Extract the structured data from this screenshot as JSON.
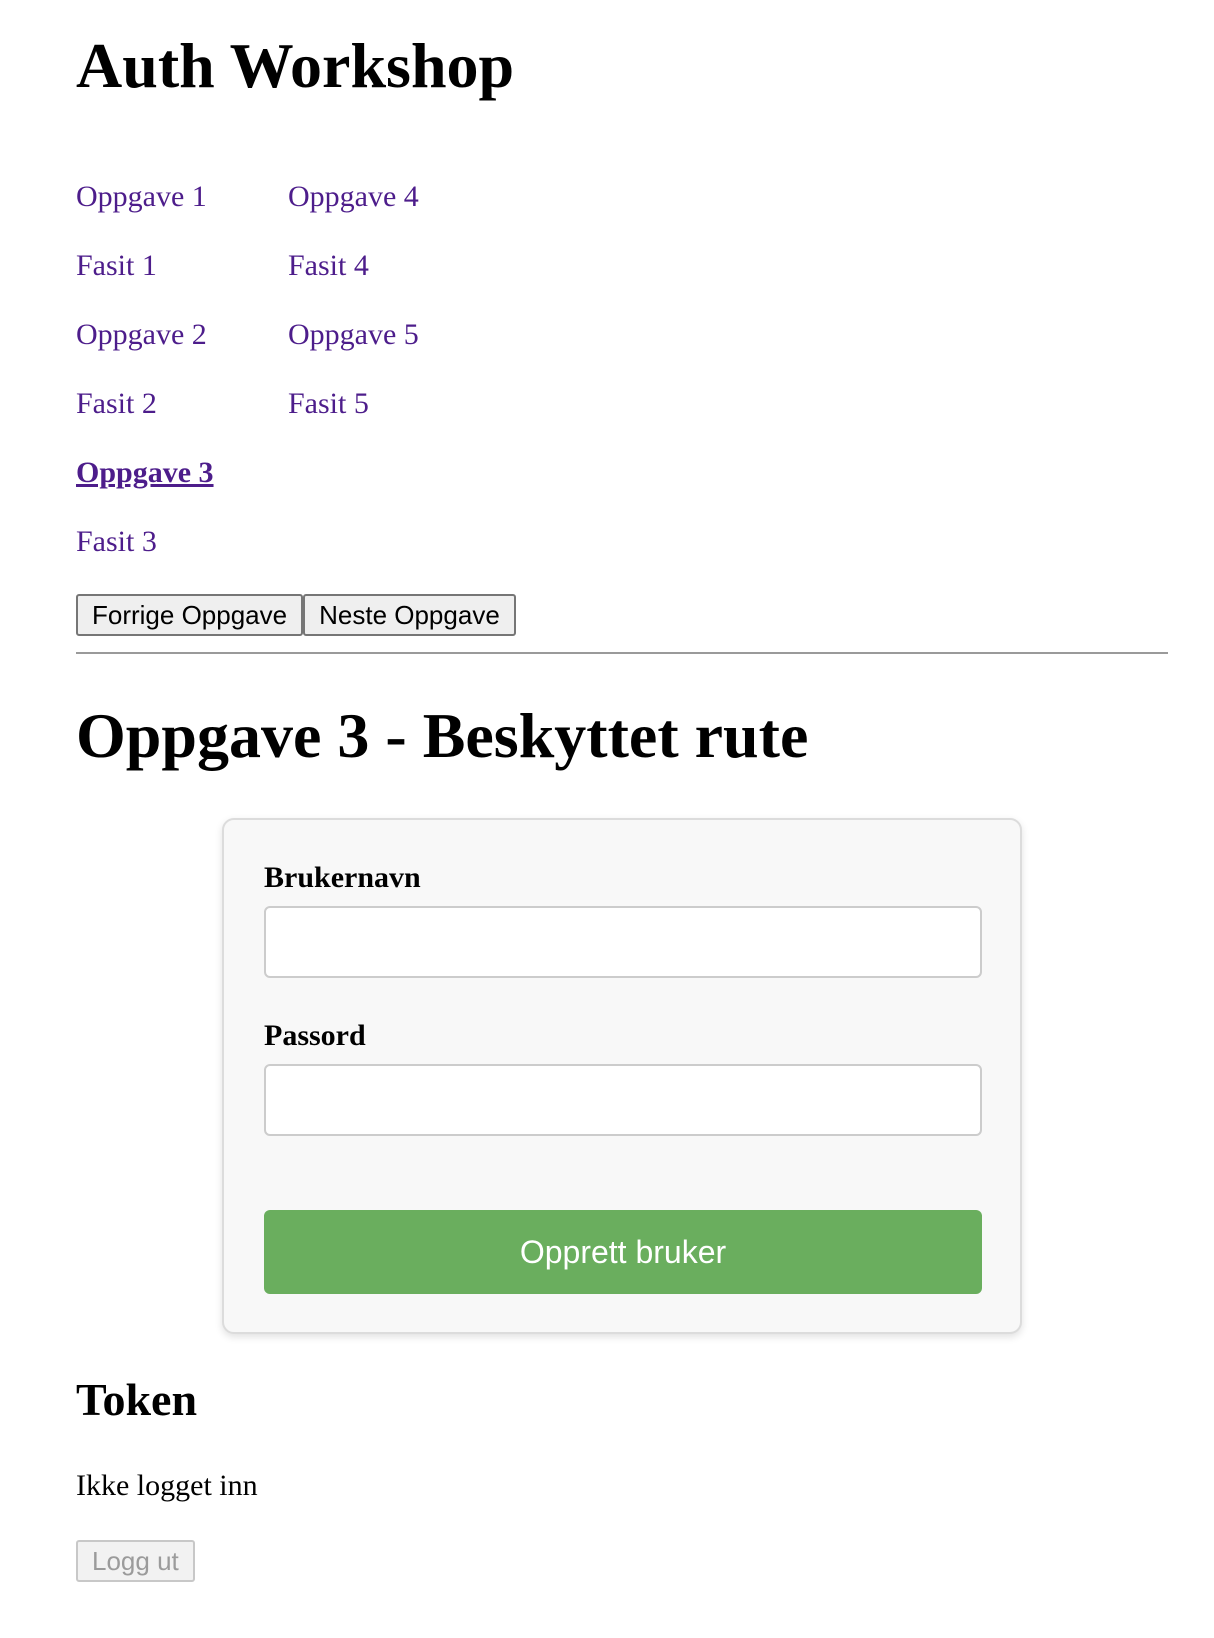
{
  "app": {
    "title": "Auth Workshop"
  },
  "nav": {
    "column_1": [
      {
        "label": "Oppgave 1",
        "active": false
      },
      {
        "label": "Fasit 1",
        "active": false
      },
      {
        "label": "Oppgave 2",
        "active": false
      },
      {
        "label": "Fasit 2",
        "active": false
      },
      {
        "label": "Oppgave 3",
        "active": true
      },
      {
        "label": "Fasit 3",
        "active": false
      }
    ],
    "column_2": [
      {
        "label": "Oppgave 4",
        "active": false
      },
      {
        "label": "Fasit 4",
        "active": false
      },
      {
        "label": "Oppgave 5",
        "active": false
      },
      {
        "label": "Fasit 5",
        "active": false
      }
    ]
  },
  "pager": {
    "previous_label": "Forrige Oppgave",
    "next_label": "Neste Oppgave"
  },
  "task": {
    "title": "Oppgave 3 - Beskyttet rute"
  },
  "form": {
    "username_label": "Brukernavn",
    "username_value": "",
    "password_label": "Passord",
    "password_value": "",
    "submit_label": "Opprett bruker"
  },
  "token": {
    "title": "Token",
    "status": "Ikke logget inn",
    "logout_label": "Logg ut",
    "logout_disabled": true
  },
  "colors": {
    "link": "#4d1d8b",
    "submit_background": "#6aae5e",
    "card_background": "#f8f8f8"
  }
}
